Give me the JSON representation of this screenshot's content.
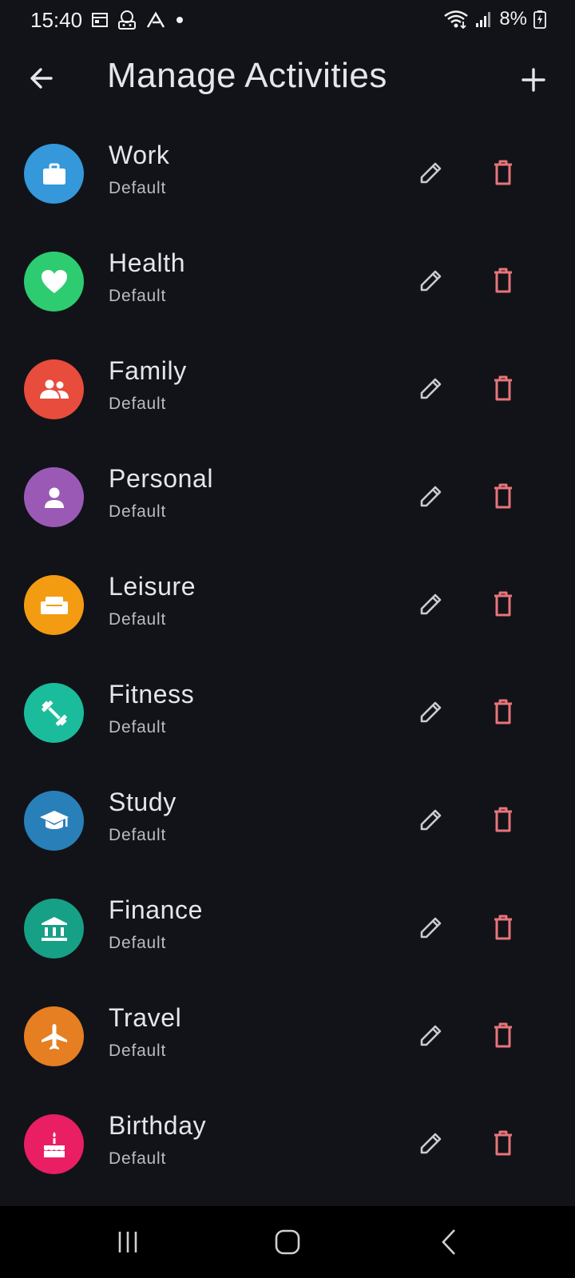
{
  "status_bar": {
    "time": "15:40",
    "battery_text": "8%",
    "left_icons": [
      "calendar-icon",
      "notification-app-icon",
      "app-a-icon",
      "dot-icon"
    ],
    "right_icons": [
      "wifi-icon",
      "signal-icon",
      "battery-charging-icon"
    ]
  },
  "app_bar": {
    "title": "Manage Activities",
    "back_icon": "arrow-back-icon",
    "add_icon": "plus-icon"
  },
  "activities": [
    {
      "name": "Work",
      "subtitle": "Default",
      "color": "#3498db",
      "icon": "briefcase-icon"
    },
    {
      "name": "Health",
      "subtitle": "Default",
      "color": "#2ecc71",
      "icon": "heart-icon"
    },
    {
      "name": "Family",
      "subtitle": "Default",
      "color": "#e74c3c",
      "icon": "people-icon"
    },
    {
      "name": "Personal",
      "subtitle": "Default",
      "color": "#9b59b6",
      "icon": "person-icon"
    },
    {
      "name": "Leisure",
      "subtitle": "Default",
      "color": "#f39c12",
      "icon": "sofa-icon"
    },
    {
      "name": "Fitness",
      "subtitle": "Default",
      "color": "#1abc9c",
      "icon": "dumbbell-icon"
    },
    {
      "name": "Study",
      "subtitle": "Default",
      "color": "#2980b9",
      "icon": "graduation-cap-icon"
    },
    {
      "name": "Finance",
      "subtitle": "Default",
      "color": "#16a085",
      "icon": "bank-icon"
    },
    {
      "name": "Travel",
      "subtitle": "Default",
      "color": "#e67e22",
      "icon": "airplane-icon"
    },
    {
      "name": "Birthday",
      "subtitle": "Default",
      "color": "#e91e63",
      "icon": "cake-icon"
    }
  ],
  "colors": {
    "background": "#111318",
    "edit_icon": "#c9cbd1",
    "delete_icon": "#e8747a"
  },
  "nav_bar": {
    "icons": [
      "recent-apps-icon",
      "home-icon",
      "back-nav-icon"
    ]
  }
}
